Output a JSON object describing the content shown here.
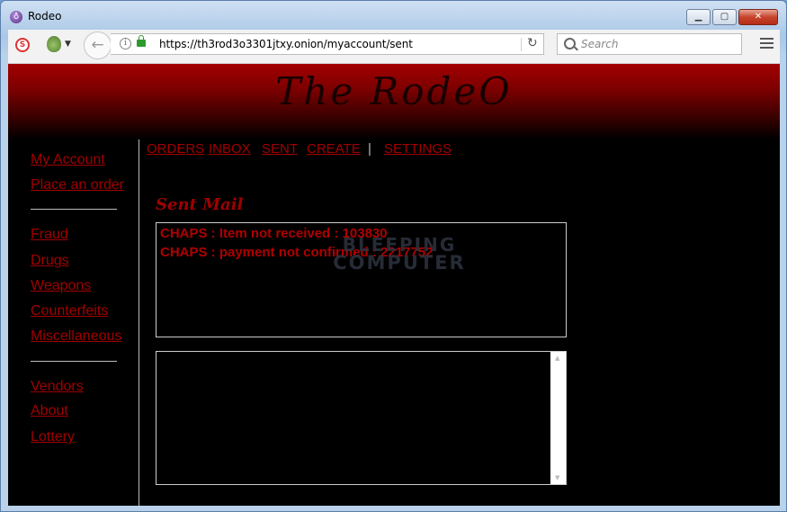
{
  "window": {
    "title": "Rodeo"
  },
  "toolbar": {
    "url": "https://th3rod3o3301jtxy.onion/myaccount/sent",
    "search_placeholder": "Search"
  },
  "banner": {
    "title": "The RodeO"
  },
  "sidebar": {
    "items": [
      {
        "label": "My Account"
      },
      {
        "label": "Place an order"
      },
      {
        "label": "Fraud"
      },
      {
        "label": "Drugs"
      },
      {
        "label": "Weapons"
      },
      {
        "label": "Counterfeits"
      },
      {
        "label": "Miscellaneous"
      },
      {
        "label": "Vendors"
      },
      {
        "label": "About"
      },
      {
        "label": "Lottery"
      }
    ]
  },
  "topnav": {
    "orders": "ORDERS",
    "inbox": "INBOX",
    "sent": "SENT",
    "create": "CREATE",
    "separator": "|",
    "settings": "SETTINGS"
  },
  "main": {
    "heading": "Sent Mail",
    "messages": [
      "CHAPS : Item not received : 103830",
      "CHAPS : payment not confirmed : 2217752"
    ]
  },
  "watermark": {
    "line1": "BLEEPING",
    "line2": "COMPUTER"
  },
  "colors": {
    "accent": "#a00000",
    "banner_top": "#a30000",
    "background": "#000000"
  }
}
